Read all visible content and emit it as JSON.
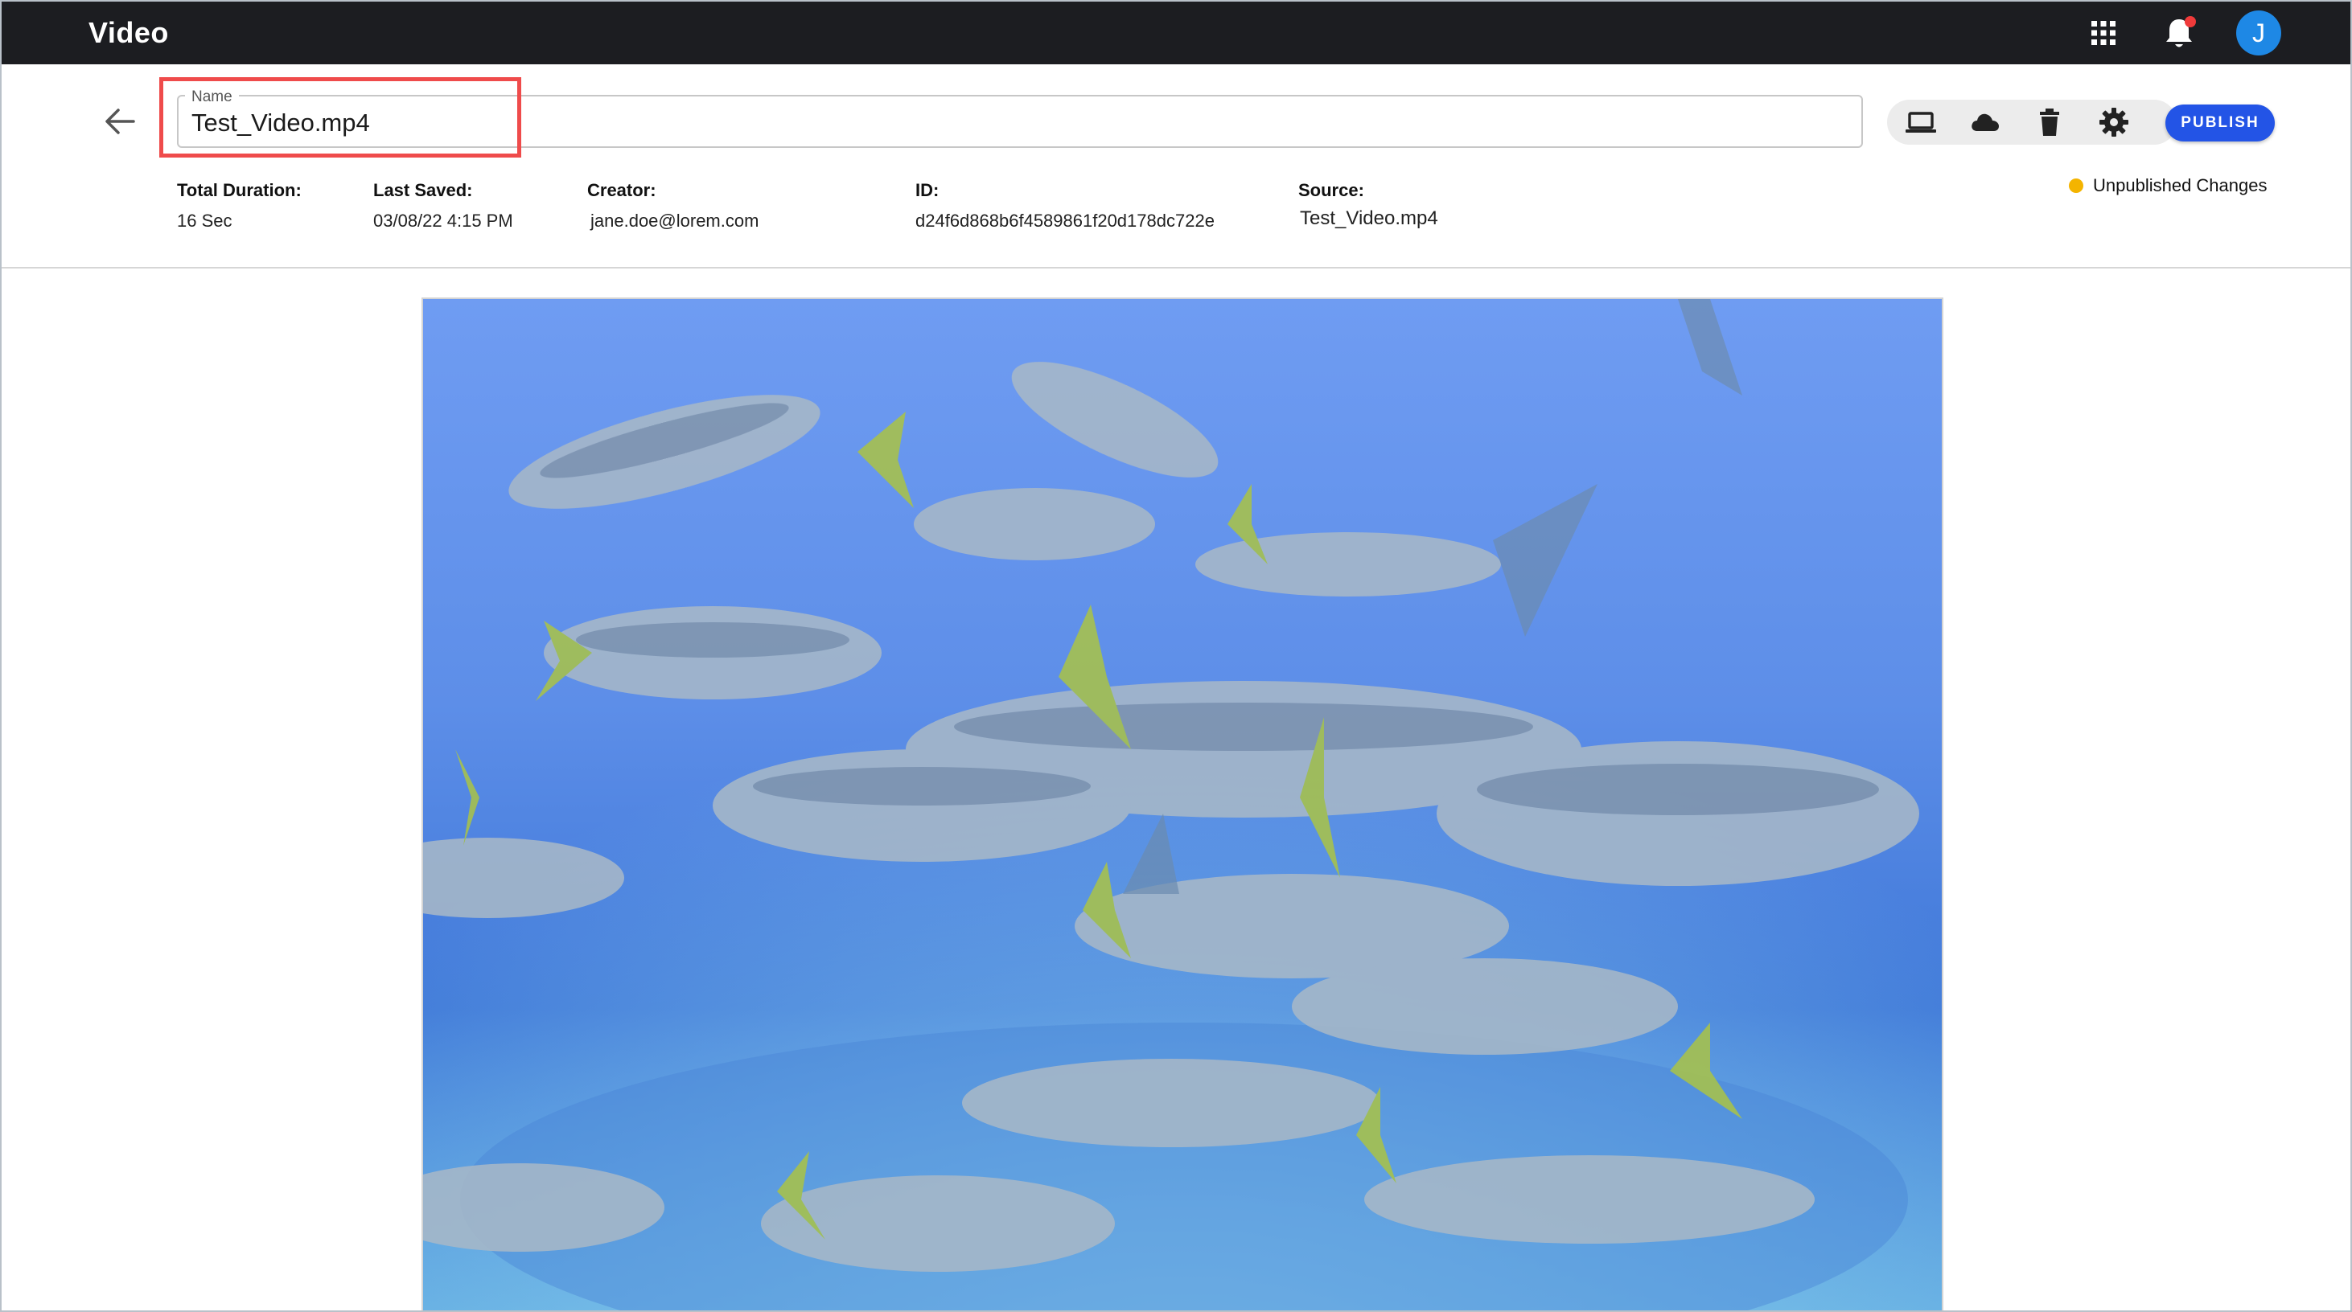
{
  "app": {
    "title": "Video"
  },
  "user": {
    "initial": "J"
  },
  "name_field": {
    "label": "Name",
    "value": "Test_Video.mp4"
  },
  "toolbar": {
    "icons": [
      "laptop-icon",
      "cloud-icon",
      "trash-icon",
      "gear-icon"
    ],
    "publish_label": "PUBLISH"
  },
  "meta": {
    "duration_label": "Total Duration:",
    "duration_value": "16 Sec",
    "saved_label": "Last Saved:",
    "saved_value": "03/08/22 4:15 PM",
    "creator_label": "Creator:",
    "creator_value": "jane.doe@lorem.com",
    "id_label": "ID:",
    "id_value": "d24f6d868b6f4589861f20d178dc722e",
    "source_label": "Source:",
    "source_value": "Test_Video.mp4"
  },
  "status": {
    "text": "Unpublished Changes",
    "color": "#f4b400"
  },
  "colors": {
    "topbar": "#1c1d21",
    "accent": "#2354e6",
    "highlight": "#ef4b4b"
  }
}
